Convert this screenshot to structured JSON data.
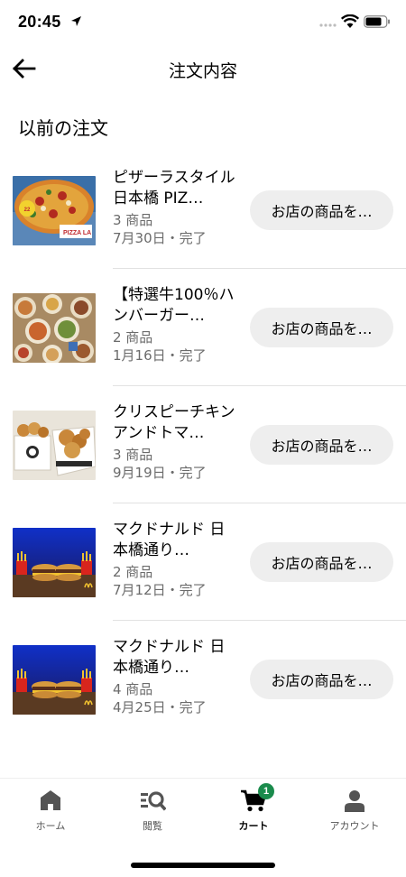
{
  "status_bar": {
    "time": "20:45"
  },
  "header": {
    "title": "注文内容"
  },
  "section": {
    "title": "以前の注文"
  },
  "orders": [
    {
      "name": "ピザーラスタイル 日本橋 PIZ…",
      "count": "3 商品",
      "date": "7月30日・完了",
      "button": "お店の商品を…",
      "thumb": "pizza-image",
      "logo_text": "PIZZA LA"
    },
    {
      "name": "【特選牛100％ハンバーガー…",
      "count": "2 商品",
      "date": "1月16日・完了",
      "button": "お店の商品を…",
      "thumb": "burger-spread-image"
    },
    {
      "name": "クリスピーチキンアンドトマ…",
      "count": "3 商品",
      "date": "9月19日・完了",
      "button": "お店の商品を…",
      "thumb": "fried-chicken-image"
    },
    {
      "name": "マクドナルド 日本橋通り…",
      "count": "2 商品",
      "date": "7月12日・完了",
      "button": "お店の商品を…",
      "thumb": "mcdonalds-image"
    },
    {
      "name": "マクドナルド 日本橋通り…",
      "count": "4 商品",
      "date": "4月25日・完了",
      "button": "お店の商品を…",
      "thumb": "mcdonalds-image"
    }
  ],
  "bottom_nav": {
    "items": [
      {
        "label": "ホーム",
        "icon": "home-icon",
        "active": false
      },
      {
        "label": "閲覧",
        "icon": "browse-icon",
        "active": false
      },
      {
        "label": "カート",
        "icon": "cart-icon",
        "active": true,
        "badge": "1"
      },
      {
        "label": "アカウント",
        "icon": "account-icon",
        "active": false
      }
    ]
  },
  "colors": {
    "badge": "#1a8b4c",
    "button_bg": "#eeeeee",
    "secondary_text": "#6b6b6b"
  }
}
